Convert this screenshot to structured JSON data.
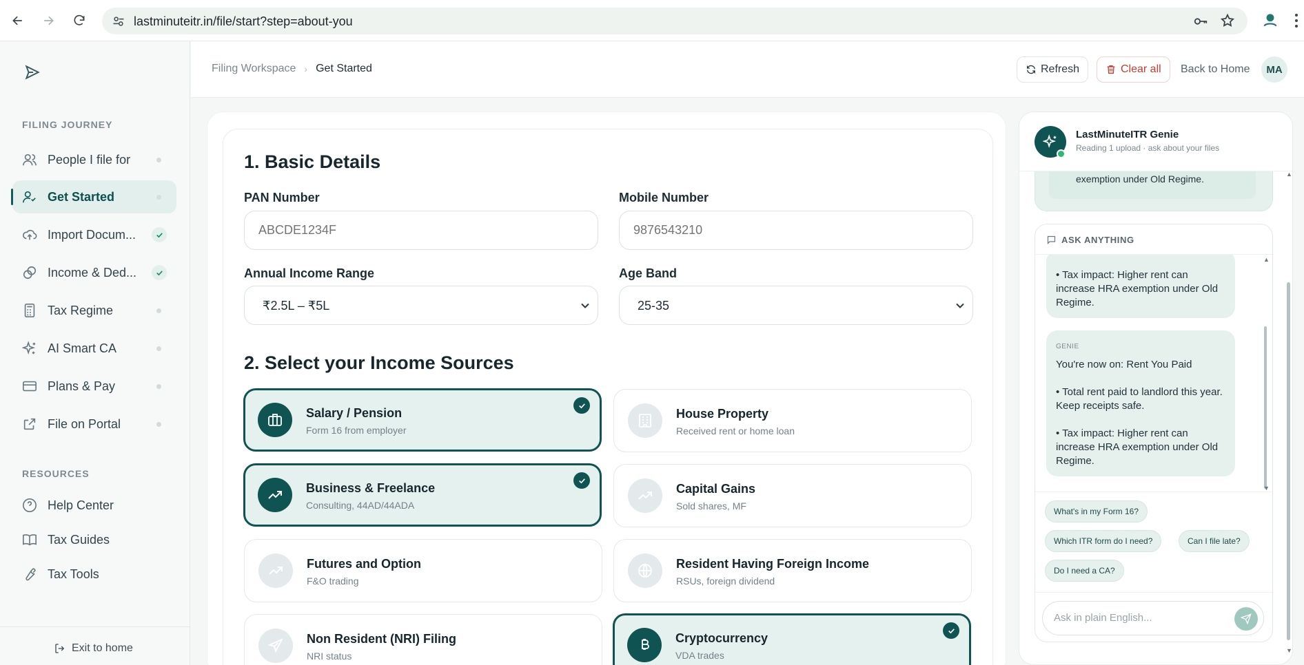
{
  "browser": {
    "url": "lastminuteitr.in/file/start?step=about-you",
    "icons": [
      "back-icon",
      "forward-icon",
      "reload-icon",
      "site-settings-icon",
      "key-icon",
      "star-icon",
      "extension-icon",
      "more-icon"
    ]
  },
  "sidebar": {
    "journey_label": "FILING JOURNEY",
    "items": [
      {
        "label": "People I file for",
        "icon": "people-icon",
        "state": "pending"
      },
      {
        "label": "Get Started",
        "icon": "user-check-icon",
        "state": "active"
      },
      {
        "label": "Import Docum...",
        "icon": "cloud-upload-icon",
        "state": "done"
      },
      {
        "label": "Income & Ded...",
        "icon": "coins-icon",
        "state": "done"
      },
      {
        "label": "Tax Regime",
        "icon": "calculator-icon",
        "state": "pending"
      },
      {
        "label": "AI Smart CA",
        "icon": "sparkles-icon",
        "state": "pending"
      },
      {
        "label": "Plans & Pay",
        "icon": "card-icon",
        "state": "pending"
      },
      {
        "label": "File on Portal",
        "icon": "external-link-icon",
        "state": "pending"
      }
    ],
    "resources_label": "RESOURCES",
    "resources": [
      {
        "label": "Help Center",
        "icon": "help-icon"
      },
      {
        "label": "Tax Guides",
        "icon": "book-icon"
      },
      {
        "label": "Tax Tools",
        "icon": "wrench-icon"
      }
    ],
    "exit_label": "Exit to home"
  },
  "header": {
    "breadcrumb": [
      "Filing Workspace",
      "Get Started"
    ],
    "refresh_label": "Refresh",
    "clear_label": "Clear all",
    "back_label": "Back to Home",
    "avatar_initials": "MA"
  },
  "form": {
    "section1_title": "1. Basic Details",
    "pan_label": "PAN Number",
    "pan_placeholder": "ABCDE1234F",
    "mobile_label": "Mobile Number",
    "mobile_placeholder": "9876543210",
    "income_label": "Annual Income Range",
    "income_value": "₹2.5L – ₹5L",
    "age_label": "Age Band",
    "age_value": "25-35",
    "section2_title": "2. Select your Income Sources",
    "sources": [
      {
        "title": "Salary / Pension",
        "sub": "Form 16 from employer",
        "selected": true,
        "icon": "briefcase-icon"
      },
      {
        "title": "House Property",
        "sub": "Received rent or home loan",
        "selected": false,
        "icon": "building-icon"
      },
      {
        "title": "Business & Freelance",
        "sub": "Consulting, 44AD/44ADA",
        "selected": true,
        "icon": "trending-up-icon"
      },
      {
        "title": "Capital Gains",
        "sub": "Sold shares, MF",
        "selected": false,
        "icon": "trending-up-icon"
      },
      {
        "title": "Futures and Option",
        "sub": "F&O trading",
        "selected": false,
        "icon": "trending-up-icon"
      },
      {
        "title": "Resident Having Foreign Income",
        "sub": "RSUs, foreign dividend",
        "selected": false,
        "icon": "globe-icon"
      },
      {
        "title": "Non Resident (NRI) Filing",
        "sub": "NRI status",
        "selected": false,
        "icon": "plane-icon"
      },
      {
        "title": "Cryptocurrency",
        "sub": "VDA trades",
        "selected": true,
        "icon": "bitcoin-icon"
      }
    ]
  },
  "genie": {
    "name": "LastMinuteITR Genie",
    "status": "Reading 1 upload · ask about your files",
    "prev_text": "exemption under Old Regime.",
    "ask_label": "ASK ANYTHING",
    "msg1": "• Tax impact: Higher rent can increase HRA exemption under Old Regime.",
    "msg2_tag": "GENIE",
    "msg2_line1": "You're now on: Rent You Paid",
    "msg2_line2": "• Total rent paid to landlord this year. Keep receipts safe.",
    "msg2_line3": "• Tax impact: Higher rent can increase HRA exemption under Old Regime.",
    "chips": [
      "What's in my Form 16?",
      "Which ITR form do I need?",
      "Can I file late?",
      "Do I need a CA?"
    ],
    "input_placeholder": "Ask in plain English..."
  }
}
